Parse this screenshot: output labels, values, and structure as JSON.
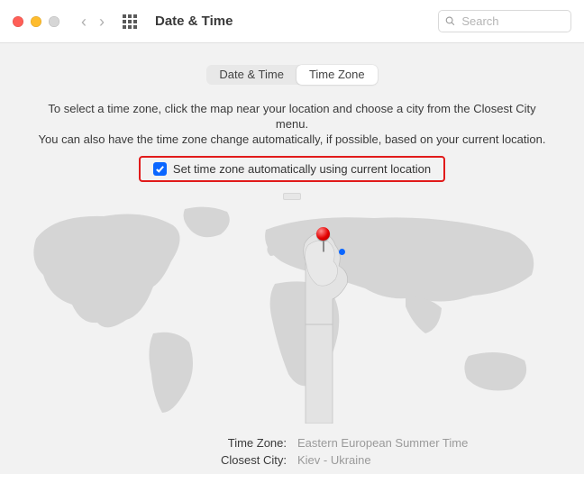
{
  "header": {
    "title": "Date & Time",
    "search_placeholder": "Search"
  },
  "tabs": {
    "date_time": "Date & Time",
    "time_zone": "Time Zone"
  },
  "instructions": {
    "line1": "To select a time zone, click the map near your location and choose a city from the Closest City menu.",
    "line2": "You can also have the time zone change automatically, if possible, based on your current location."
  },
  "auto_checkbox": {
    "label": "Set time zone automatically using current location",
    "checked": true
  },
  "info": {
    "timezone_label": "Time Zone:",
    "timezone_value": "Eastern European Summer Time",
    "city_label": "Closest City:",
    "city_value": "Kiev - Ukraine"
  }
}
